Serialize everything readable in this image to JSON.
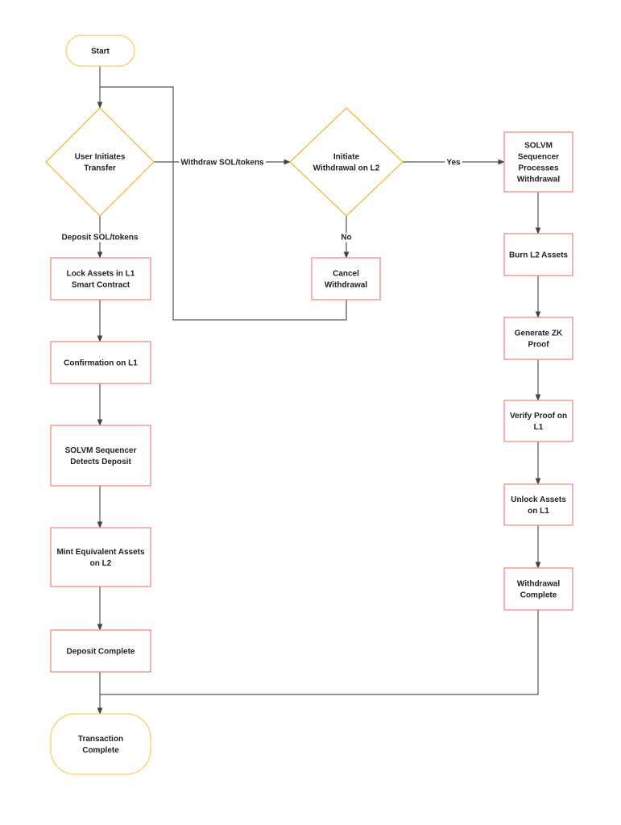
{
  "colors": {
    "terminal": "#f7cf6a",
    "decision": "#f3b93c",
    "process": "#f08a8a",
    "edge": "#555555"
  },
  "nodes": {
    "start": {
      "type": "terminal",
      "lines": [
        "Start"
      ]
    },
    "user_initiates": {
      "type": "decision",
      "lines": [
        "User Initiates",
        "Transfer"
      ]
    },
    "initiate_withdrawal": {
      "type": "decision",
      "lines": [
        "Initiate",
        "Withdrawal on L2"
      ]
    },
    "lock_assets": {
      "type": "process",
      "lines": [
        "Lock Assets in L1",
        "Smart Contract"
      ]
    },
    "cancel_withdrawal": {
      "type": "process",
      "lines": [
        "Cancel",
        "Withdrawal"
      ]
    },
    "confirmation": {
      "type": "process",
      "lines": [
        "Confirmation on L1"
      ]
    },
    "detects_deposit": {
      "type": "process",
      "lines": [
        "SOLVM  Sequencer",
        "Detects Deposit"
      ]
    },
    "mint": {
      "type": "process",
      "lines": [
        "Mint Equivalent Assets",
        "on L2"
      ]
    },
    "deposit_complete": {
      "type": "process",
      "lines": [
        "Deposit Complete"
      ]
    },
    "transaction_complete": {
      "type": "terminal",
      "lines": [
        "Transaction",
        "Complete"
      ]
    },
    "processes_withdrawal": {
      "type": "process",
      "lines": [
        "SOLVM",
        "Sequencer",
        "Processes",
        "Withdrawal"
      ]
    },
    "burn": {
      "type": "process",
      "lines": [
        "Burn L2 Assets"
      ]
    },
    "zk_proof": {
      "type": "process",
      "lines": [
        "Generate ZK",
        "Proof"
      ]
    },
    "verify": {
      "type": "process",
      "lines": [
        "Verify Proof on",
        "L1"
      ]
    },
    "unlock": {
      "type": "process",
      "lines": [
        "Unlock Assets",
        "on L1"
      ]
    },
    "withdrawal_complete": {
      "type": "process",
      "lines": [
        "Withdrawal",
        "Complete"
      ]
    }
  },
  "edge_labels": {
    "withdraw": "Withdraw SOL/tokens",
    "deposit": "Deposit SOL/tokens",
    "yes": "Yes",
    "no": "No"
  }
}
